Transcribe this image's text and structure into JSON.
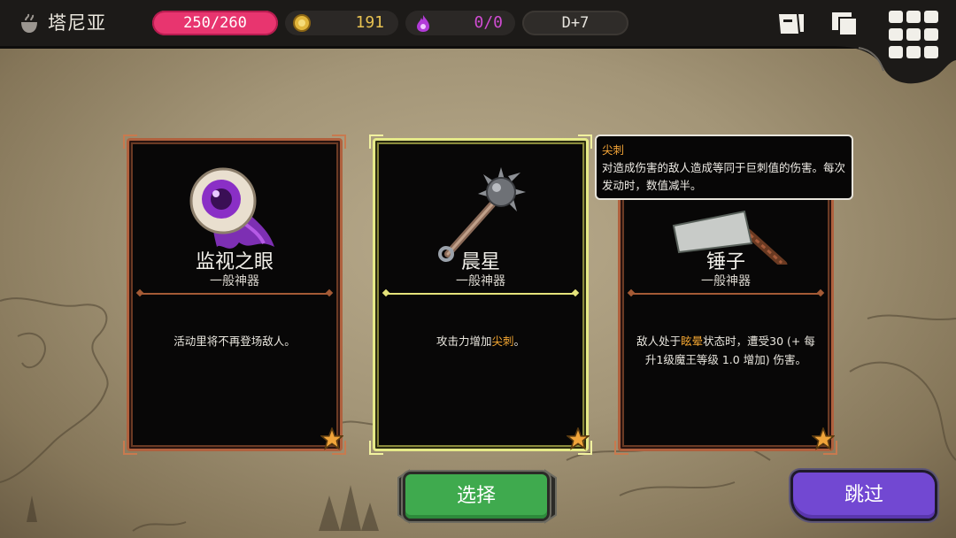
{
  "topbar": {
    "location_icon": "cauldron-icon",
    "location_name": "塔尼亚",
    "hp": "250/260",
    "gold_icon": "coin-icon",
    "gold": "191",
    "soul_icon": "purple-flame-icon",
    "souls": "0/0",
    "day": "D+7",
    "buttons": [
      "quest-scroll-icon",
      "map-icon",
      "menu-grid-icon"
    ]
  },
  "cards": [
    {
      "name": "监视之眼",
      "rarity": "一般神器",
      "art_icon": "purple-eye-icon",
      "desc_parts": [
        "活动里将不再登场敌人。"
      ],
      "selected": false
    },
    {
      "name": "晨星",
      "rarity": "一般神器",
      "art_icon": "morning-star-mace-icon",
      "desc_before": "攻击力增加",
      "desc_highlight": "尖刺",
      "desc_after": "。",
      "selected": true
    },
    {
      "name": "锤子",
      "rarity": "一般神器",
      "art_icon": "hammer-icon",
      "desc_before": "敌人处于",
      "desc_highlight": "眩晕",
      "desc_after": "状态时，遭受30 (+ 每升1级魔王等级 1.0 增加) 伤害。",
      "selected": false
    }
  ],
  "tooltip": {
    "title": "尖刺",
    "body": "对造成伤害的敌人造成等同于巨刺值的伤害。每次发动时，数值减半。"
  },
  "actions": {
    "select_label": "选择",
    "skip_label": "跳过"
  },
  "colors": {
    "hp_pill": "#e8356f",
    "gold_text": "#e8c251",
    "soul_text": "#d04cd2",
    "highlight": "#f2a531",
    "select_button": "#3faa4e",
    "skip_button": "#7248d2"
  }
}
